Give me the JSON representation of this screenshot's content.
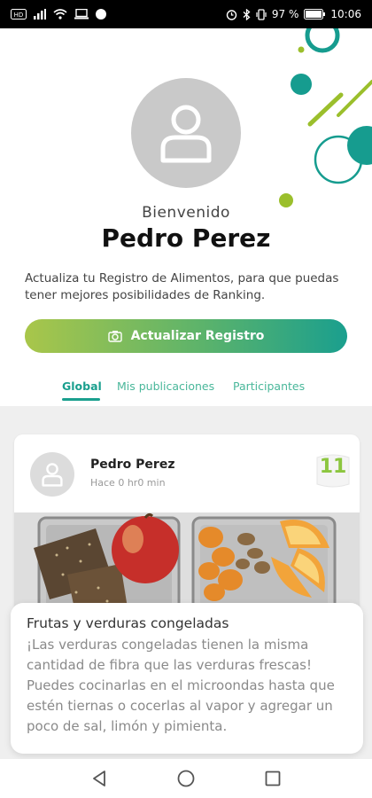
{
  "status_bar": {
    "battery_percent": "97 %",
    "time": "10:06",
    "icons": [
      "nfc-icon",
      "signal-icon",
      "wifi-icon",
      "screen-cast-icon",
      "dot-icon",
      "alarm-icon",
      "bluetooth-icon",
      "vibrate-icon",
      "battery-icon"
    ]
  },
  "colors": {
    "accent_teal": "#1a9f8e",
    "accent_green": "#8cc63f",
    "deco_teal": "#169c8f",
    "deco_lime": "#9bbf2c"
  },
  "profile": {
    "welcome": "Bienvenido",
    "name": "Pedro Perez",
    "info": "Actualiza tu Registro de Alimentos, para que puedas tener mejores posibilidades de Ranking.",
    "cta_label": "Actualizar Registro"
  },
  "tabs": [
    {
      "label": "Global",
      "active": true
    },
    {
      "label": "Mis publicaciones",
      "active": false
    },
    {
      "label": "Participantes",
      "active": false
    }
  ],
  "post": {
    "author": "Pedro Perez",
    "time": "Hace 0 hr0 min",
    "score": "11"
  },
  "tip": {
    "title": "Frutas y verduras congeladas",
    "body": "¡Las verduras congeladas tienen la misma cantidad de fibra que las verduras frescas! Puedes cocinarlas en el microondas hasta que estén tiernas o cocerlas al vapor y agregar un poco de sal, limón y pimienta."
  },
  "nav": [
    "back-icon",
    "home-icon",
    "recents-icon"
  ]
}
